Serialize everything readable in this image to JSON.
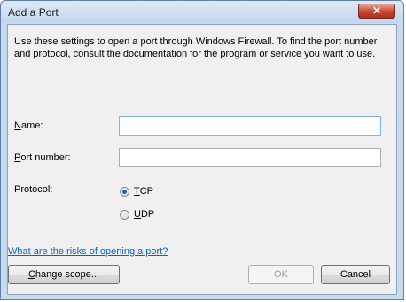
{
  "window": {
    "title": "Add a Port",
    "close_glyph": "✕"
  },
  "description": "Use these settings to open a port through Windows Firewall. To find the port number and protocol, consult the documentation for the program or service you want to use.",
  "name": {
    "label_accel": "N",
    "label_rest": "ame:",
    "value": ""
  },
  "port_number": {
    "label_accel": "P",
    "label_rest": "ort number:",
    "value": ""
  },
  "protocol": {
    "label": "Protocol:",
    "options": [
      {
        "accel": "T",
        "rest": "CP",
        "selected": true
      },
      {
        "accel": "U",
        "rest": "DP",
        "selected": false
      }
    ]
  },
  "risk_link": "What are the risks of opening a port?",
  "buttons": {
    "change_scope_accel": "C",
    "change_scope_rest": "hange scope...",
    "ok": "OK",
    "cancel": "Cancel"
  }
}
